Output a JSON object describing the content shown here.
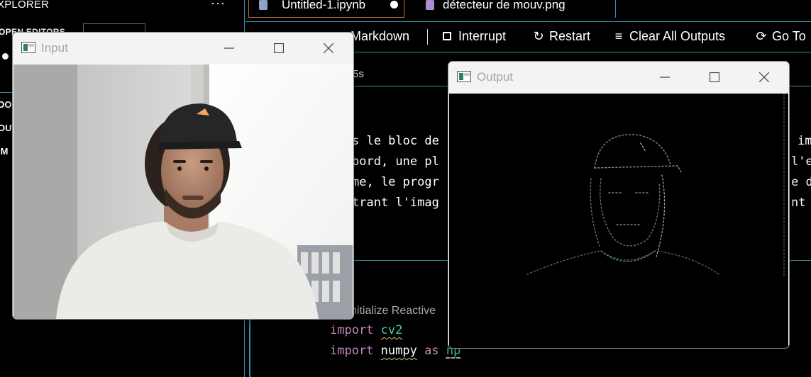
{
  "explorer": {
    "title": "XPLORER",
    "more": "···",
    "open_editors": "OPEN EDITORS",
    "sections": [
      "DO",
      "OUT",
      "IM"
    ]
  },
  "tabs": [
    {
      "label": "Untitled-1.ipynb",
      "modified": true,
      "icon": "notebook-icon"
    },
    {
      "label": "détecteur de mouv.png",
      "icon": "image-file-icon"
    }
  ],
  "toolbar": {
    "markdown": "Markdown",
    "interrupt": "Interrupt",
    "restart": "Restart",
    "clear_all": "Clear All Outputs",
    "goto": "Go To"
  },
  "cell": {
    "status": "5s",
    "markdown_left": [
      "s le bloc de",
      "bord, une pl",
      "me, le progr",
      "trant l'imag"
    ],
    "markdown_right": [
      "im",
      "l'e",
      "e d",
      "nt"
    ],
    "comment": "nitialize Reactive",
    "code": [
      {
        "kw": "import",
        "mod": "cv2"
      },
      {
        "kw": "import",
        "mod": "numpy",
        "as": "as",
        "alias": "np"
      }
    ]
  },
  "windows": {
    "input": {
      "title": "Input"
    },
    "output": {
      "title": "Output"
    }
  },
  "colors": {
    "accent_line": "#3a8ea8",
    "tab_border": "#c26b2c",
    "keyword": "#c586c0",
    "module": "#4ec9b0"
  }
}
